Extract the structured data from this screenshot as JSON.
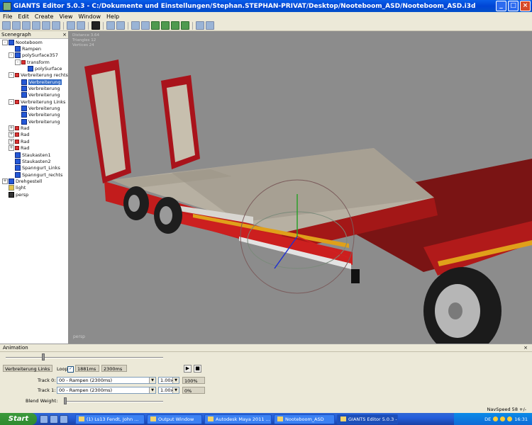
{
  "window": {
    "title": "GIANTS Editor 5.0.3 - C:/Dokumente und Einstellungen/Stephan.STEPHAN-PRIVAT/Desktop/Nooteboom_ASD/Nooteboom_ASD.i3d",
    "controls": [
      "_",
      "□",
      "×"
    ]
  },
  "menu": [
    "File",
    "Edit",
    "Create",
    "View",
    "Window",
    "Help"
  ],
  "scenegraph": {
    "title": "Scenegraph",
    "close": "×",
    "nodes": [
      {
        "label": "Nooteboom",
        "indent": 0,
        "exp": "-",
        "icon": "shape-icon"
      },
      {
        "label": "Rampen",
        "indent": 1,
        "exp": "",
        "icon": "shape-icon"
      },
      {
        "label": "polySurface357",
        "indent": 1,
        "exp": "-",
        "icon": "shape-icon"
      },
      {
        "label": "transform",
        "indent": 2,
        "exp": "-",
        "icon": "transform-icon"
      },
      {
        "label": "polySurface",
        "indent": 3,
        "exp": "",
        "icon": "shape-icon"
      },
      {
        "label": "Verbreiterung rechts",
        "indent": 1,
        "exp": "-",
        "icon": "transform-icon"
      },
      {
        "label": "Verbreiterung",
        "indent": 2,
        "exp": "",
        "icon": "shape-icon",
        "selected": true
      },
      {
        "label": "Verbreiterung",
        "indent": 2,
        "exp": "",
        "icon": "shape-icon"
      },
      {
        "label": "Verbreiterung",
        "indent": 2,
        "exp": "",
        "icon": "shape-icon"
      },
      {
        "label": "Verbreiterung Links",
        "indent": 1,
        "exp": "-",
        "icon": "transform-icon"
      },
      {
        "label": "Verbreiterung",
        "indent": 2,
        "exp": "",
        "icon": "shape-icon"
      },
      {
        "label": "Verbreiterung",
        "indent": 2,
        "exp": "",
        "icon": "shape-icon"
      },
      {
        "label": "Verbreiterung",
        "indent": 2,
        "exp": "",
        "icon": "shape-icon"
      },
      {
        "label": "Rad",
        "indent": 1,
        "exp": "+",
        "icon": "transform-icon"
      },
      {
        "label": "Rad",
        "indent": 1,
        "exp": "+",
        "icon": "transform-icon"
      },
      {
        "label": "Rad",
        "indent": 1,
        "exp": "+",
        "icon": "transform-icon"
      },
      {
        "label": "Rad",
        "indent": 1,
        "exp": "+",
        "icon": "transform-icon"
      },
      {
        "label": "Staukasten1",
        "indent": 1,
        "exp": "",
        "icon": "shape-icon"
      },
      {
        "label": "Staukasten2",
        "indent": 1,
        "exp": "",
        "icon": "shape-icon"
      },
      {
        "label": "Spanngurt_Links",
        "indent": 1,
        "exp": "",
        "icon": "shape-icon"
      },
      {
        "label": "Spanngurt_rechts",
        "indent": 1,
        "exp": "",
        "icon": "shape-icon"
      },
      {
        "label": "Drehgestell",
        "indent": 0,
        "exp": "+",
        "icon": "shape-icon"
      },
      {
        "label": "light",
        "indent": 0,
        "exp": "",
        "icon": "light-icon"
      },
      {
        "label": "persp",
        "indent": 0,
        "exp": "",
        "icon": "camera-icon"
      }
    ]
  },
  "viewport": {
    "info": [
      "Distance 3.64",
      "Triangles 12",
      "Vertices 24"
    ],
    "camera_label": "persp"
  },
  "animation": {
    "title": "Animation",
    "close": "×",
    "clip_name": "Verbreiterung Links",
    "loop_label": "Loop",
    "loop_checked": "✓",
    "duration": "1881ms",
    "time": "2300ms",
    "play": "▶",
    "stop": "■",
    "track0_label": "Track 0:",
    "track0_value": "00 - Rampen (2300ms)",
    "track0_speed": "1.00x",
    "track0_weight": "100%",
    "track1_label": "Track 1:",
    "track1_value": "00 - Rampen (2300ms)",
    "track1_speed": "1.00x",
    "track1_weight": "0%",
    "blend_label": "Blend Weight:",
    "time_slider_level": 0.23,
    "blend_slider_level": 0.0
  },
  "status": {
    "navspeed": "NavSpeed 58 +/-"
  },
  "taskbar": {
    "start": "Start",
    "items": [
      {
        "label": "(1) Ls13 Fendt, John ...",
        "active": false
      },
      {
        "label": "Output Window",
        "active": false
      },
      {
        "label": "Autodesk Maya 2011 ...",
        "active": false
      },
      {
        "label": "Nooteboom_ASD",
        "active": false
      },
      {
        "label": "GIANTS Editor 5.0.3 -...",
        "active": true
      }
    ],
    "lang": "DE",
    "clock": "16:31"
  }
}
